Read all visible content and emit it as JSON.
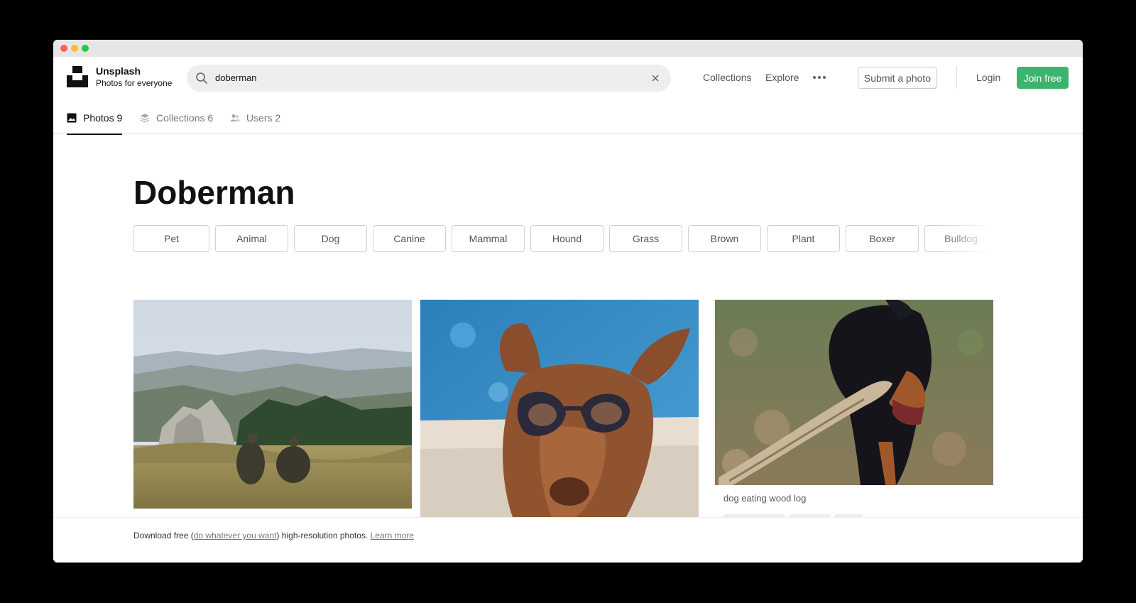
{
  "app": {
    "name": "Unsplash",
    "tagline": "Photos for everyone"
  },
  "search": {
    "query": "doberman"
  },
  "nav": {
    "collections": "Collections",
    "explore": "Explore",
    "submit": "Submit a photo",
    "login": "Login",
    "join": "Join free"
  },
  "tabs": [
    {
      "label": "Photos 9",
      "icon": "image-icon",
      "active": true
    },
    {
      "label": "Collections 6",
      "icon": "stack-icon",
      "active": false
    },
    {
      "label": "Users 2",
      "icon": "users-icon",
      "active": false
    }
  ],
  "page": {
    "title": "Doberman"
  },
  "related": [
    "Pet",
    "Animal",
    "Dog",
    "Canine",
    "Mammal",
    "Hound",
    "Grass",
    "Brown",
    "Plant",
    "Boxer",
    "Bulldog"
  ],
  "photos": [
    {
      "caption": ""
    },
    {
      "caption": ""
    },
    {
      "caption": "dog eating wood log"
    }
  ],
  "footer": {
    "prefix": "Download free (",
    "link1": "do whatever you want",
    "middle": ") high-resolution photos. ",
    "link2": "Learn more"
  },
  "colors": {
    "accent": "#3cb46e",
    "text": "#111111",
    "muted": "#777777"
  }
}
